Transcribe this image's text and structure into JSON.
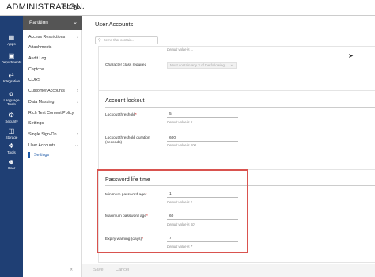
{
  "app": {
    "title": "ADMINISTRATION",
    "logo_text": "easy..."
  },
  "rail": {
    "items": [
      {
        "label": "Apps",
        "icon": "apps-grid-icon"
      },
      {
        "label": "Departments",
        "icon": "org-chart-icon"
      },
      {
        "label": "Integration",
        "icon": "integration-icon"
      },
      {
        "label": "Language Tools",
        "icon": "translate-icon"
      },
      {
        "label": "Security",
        "icon": "gear-icon"
      },
      {
        "label": "Storage",
        "icon": "database-icon"
      },
      {
        "label": "Tools",
        "icon": "wrench-icon"
      },
      {
        "label": "User",
        "icon": "user-icon"
      }
    ]
  },
  "menu": {
    "header": "Partition",
    "items": [
      {
        "label": "Access Restrictions",
        "arrow": "›"
      },
      {
        "label": "Attachments"
      },
      {
        "label": "Audit Log"
      },
      {
        "label": "Captcha"
      },
      {
        "label": "CORS"
      },
      {
        "label": "Customer Accounts",
        "arrow": "›"
      },
      {
        "label": "Data Masking",
        "arrow": "›"
      },
      {
        "label": "Rich Text Content Policy"
      },
      {
        "label": "Settings"
      },
      {
        "label": "Single Sign-On",
        "arrow": "›"
      },
      {
        "label": "User Accounts",
        "arrow": "⌄"
      },
      {
        "label": "Settings"
      }
    ]
  },
  "page": {
    "title": "User Accounts",
    "search_placeholder": "Items that contain...",
    "char_class": {
      "label": "Character class required",
      "value": "Must contain any 3 of the following...",
      "top_hint": "Default value is ..."
    },
    "lockout": {
      "title": "Account lockout",
      "threshold_label": "Lockout threshold",
      "threshold_value": "5",
      "threshold_hint": "Default value is 5",
      "duration_label": "Lockout threshold duration (seconds)",
      "duration_value": "600",
      "duration_hint": "Default value is 600"
    },
    "password": {
      "title": "Password life time",
      "min_label": "Minimum password age",
      "min_value": "1",
      "min_hint": "Default value is 1",
      "max_label": "Maximum password age",
      "max_value": "60",
      "max_hint": "Default value is 60",
      "warn_label": "Expiry warning (days)",
      "warn_value": "7",
      "warn_hint": "Default value is 7"
    }
  },
  "footer": {
    "save": "Save",
    "cancel": "Cancel"
  },
  "colors": {
    "rail": "#1f3f74",
    "accent": "#1e5aa8",
    "highlight": "#d9534f"
  }
}
